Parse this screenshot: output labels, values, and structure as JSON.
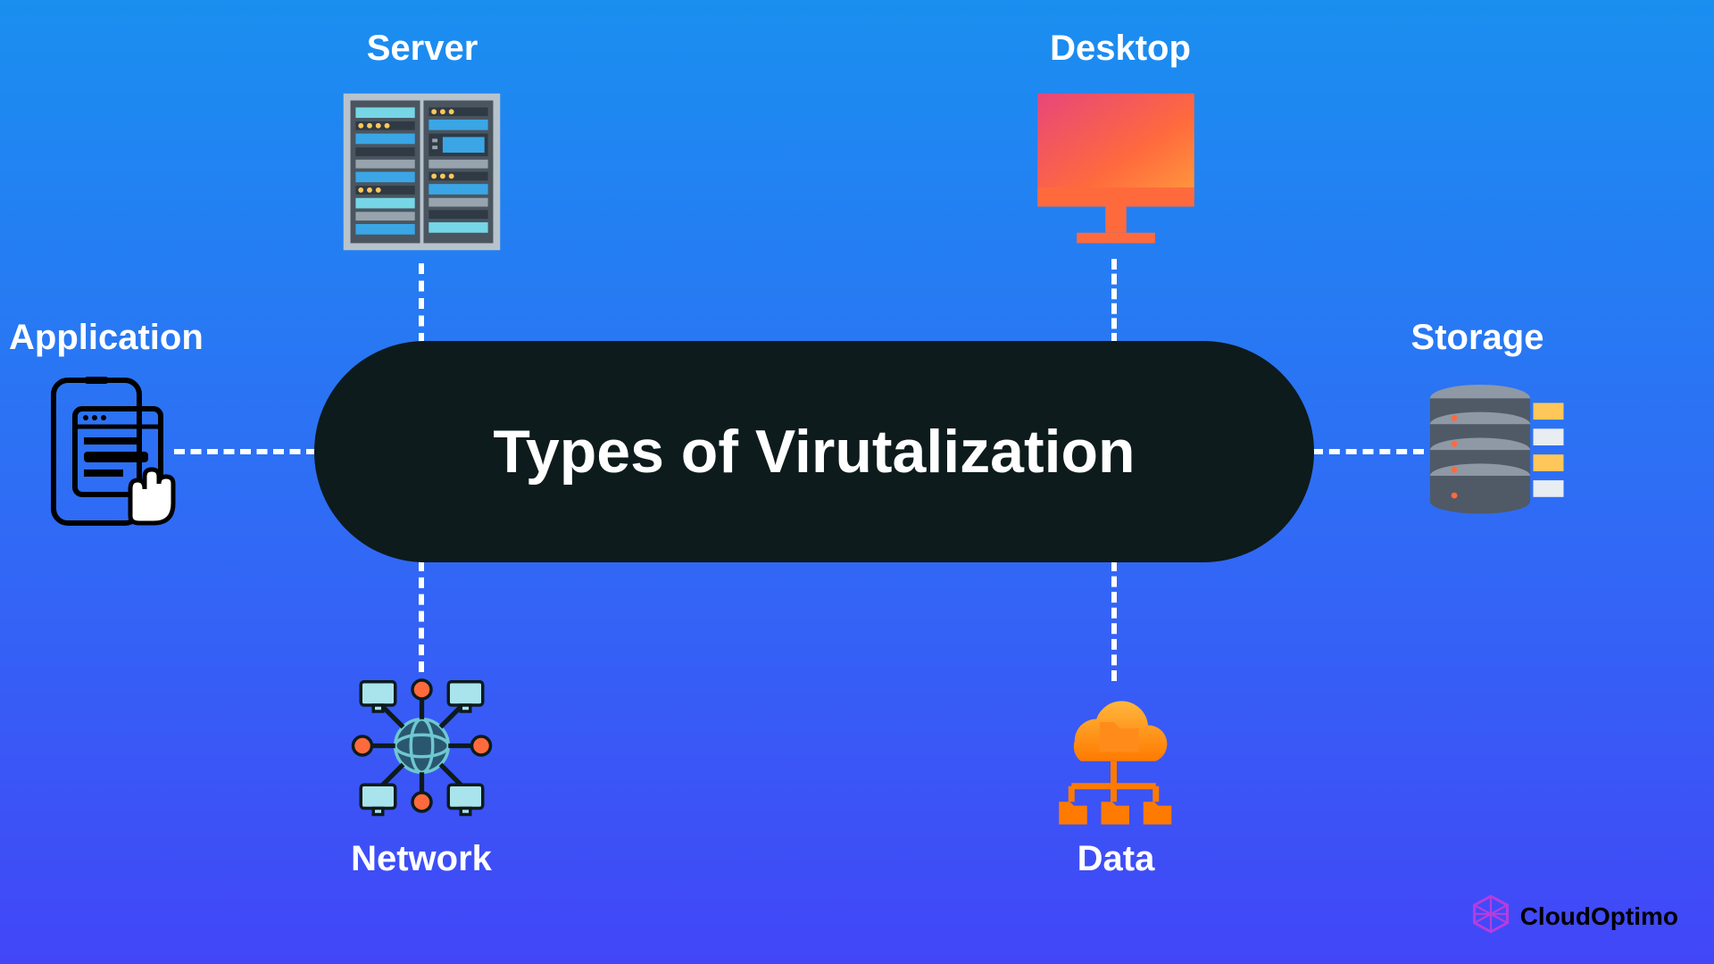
{
  "center": {
    "title": "Types of Virutalization"
  },
  "nodes": {
    "server": {
      "label": "Server"
    },
    "desktop": {
      "label": "Desktop"
    },
    "application": {
      "label": "Application"
    },
    "storage": {
      "label": "Storage"
    },
    "network": {
      "label": "Network"
    },
    "data": {
      "label": "Data"
    }
  },
  "brand": {
    "name": "CloudOptimo"
  },
  "colors": {
    "bg_top": "#1a8ff0",
    "bg_mid": "#2e6ef5",
    "bg_bot": "#4246f7",
    "pill": "#0d1b1c",
    "text": "#ffffff",
    "accent_orange": "#ff7a00",
    "accent_teal": "#6ec7d1",
    "brand_purple": "#b63ce0"
  },
  "diagram": {
    "layout": "hub-and-spoke",
    "hub": "center",
    "spokes": [
      "server",
      "desktop",
      "application",
      "storage",
      "network",
      "data"
    ]
  }
}
